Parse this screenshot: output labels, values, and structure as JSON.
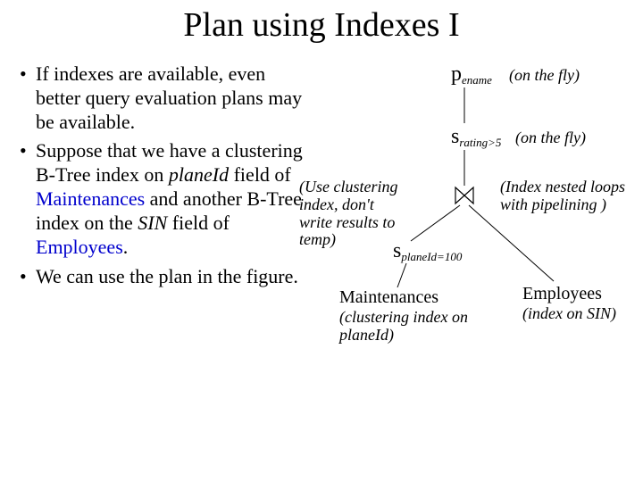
{
  "title": "Plan using Indexes I",
  "bullets": {
    "b1_pre": "If indexes are available, even better query evaluation plans may be available.",
    "b2_pre": "Suppose that we have a clustering B-Tree index on ",
    "b2_planeId": "planeId",
    "b2_mid1": " field of ",
    "b2_maint": "Maintenances",
    "b2_mid2": " and another B-Tree index on the ",
    "b2_sin": "SIN",
    "b2_mid3": " field of ",
    "b2_emp": "Employees",
    "b2_end": ".",
    "b3": "We can use the plan in the figure."
  },
  "diagram": {
    "pi": "p",
    "pi_sub": "ename",
    "pi_ann": "(on the fly)",
    "sigma1": "s",
    "sigma1_sub": "rating>5",
    "sigma1_ann": "(on the fly)",
    "join_left_ann": "(Use clustering index, don't write results to temp)",
    "join_right_ann": "(Index nested loops with pipelining )",
    "sigma2": "s",
    "sigma2_sub": "planeId=100",
    "left_rel": "Maintenances",
    "left_rel_ann": "(clustering index on planeId)",
    "right_rel": "Employees",
    "right_rel_ann": "(index on SIN)"
  }
}
